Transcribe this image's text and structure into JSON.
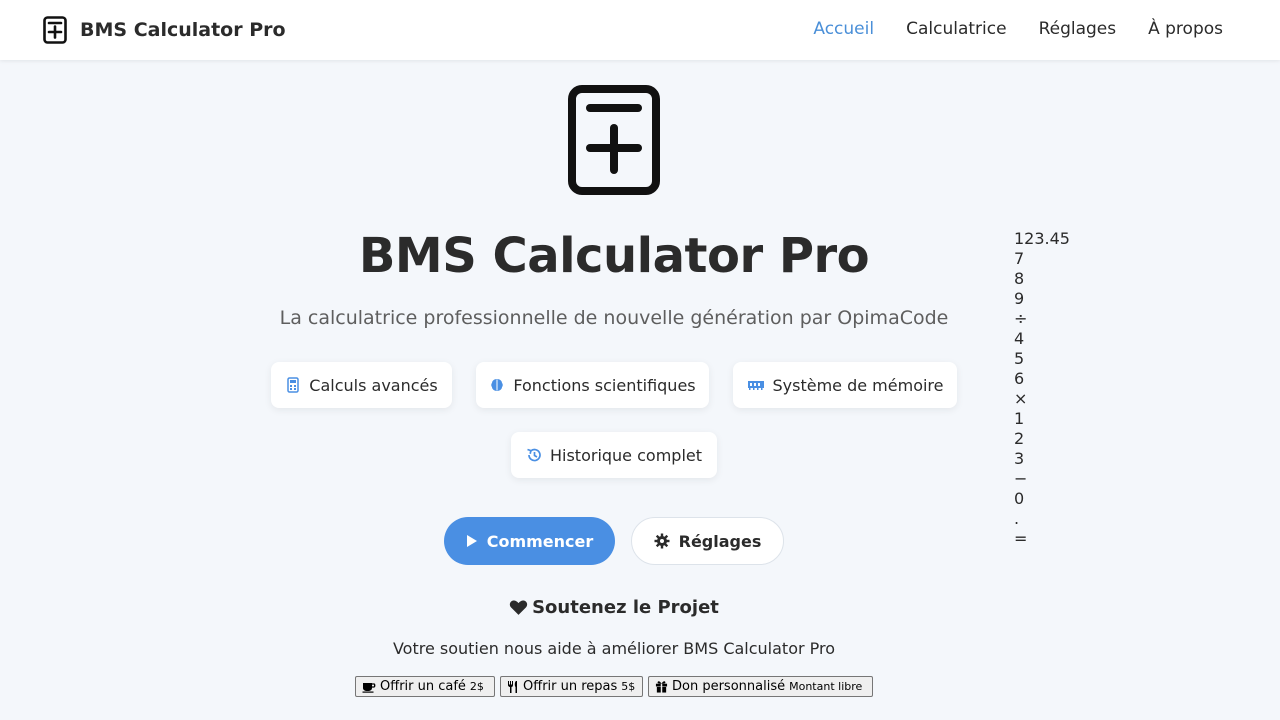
{
  "header": {
    "brand_title": "BMS Calculator Pro",
    "nav": [
      "Accueil",
      "Calculatrice",
      "Réglages",
      "À propos"
    ],
    "active_nav": "Accueil"
  },
  "hero": {
    "title": "BMS Calculator Pro",
    "subtitle": "La calculatrice professionnelle de nouvelle génération par OpimaCode"
  },
  "features": [
    {
      "label": "Calculs avancés",
      "icon": "calculator-icon"
    },
    {
      "label": "Fonctions scientifiques",
      "icon": "brain-icon"
    },
    {
      "label": "Système de mémoire",
      "icon": "memory-icon"
    },
    {
      "label": "Historique complet",
      "icon": "history-icon"
    }
  ],
  "actions": {
    "start_label": "Commencer",
    "settings_label": "Réglages"
  },
  "support": {
    "title": "Soutenez le Projet",
    "text": "Votre soutien nous aide à améliorer BMS Calculator Pro",
    "donations": [
      {
        "label": "Offrir un café",
        "amount": "2$",
        "icon": "coffee-icon"
      },
      {
        "label": "Offrir un repas",
        "amount": "5$",
        "icon": "utensils-icon"
      },
      {
        "label": "Don personnalisé",
        "amount": "Montant libre",
        "icon": "gift-icon"
      }
    ]
  },
  "calculator": {
    "display": "123.45",
    "keys": [
      "7",
      "8",
      "9",
      "÷",
      "4",
      "5",
      "6",
      "×",
      "1",
      "2",
      "3",
      "−",
      "0",
      ".",
      "="
    ]
  },
  "colors": {
    "accent": "#4a8fe3",
    "background": "#f4f7fb",
    "text": "#2b2b2b"
  }
}
